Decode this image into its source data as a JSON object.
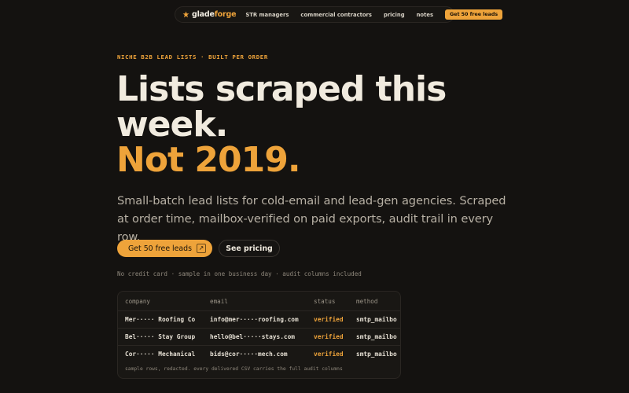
{
  "nav": {
    "brand_prefix": "glade",
    "brand_suffix": "forge",
    "links": [
      "STR managers",
      "commercial contractors",
      "pricing",
      "notes"
    ],
    "cta_label": "Get 50 free leads"
  },
  "hero": {
    "eyebrow": "NICHE B2B LEAD LISTS · BUILT PER ORDER",
    "headline_line1": "Lists scraped this",
    "headline_line2": "week.",
    "headline_accent": "Not 2019.",
    "subhead": "Small-batch lead lists for cold-email and lead-gen agencies. Scraped at order time, mailbox-verified on paid exports, audit trail in every row.",
    "primary_button": "Get 50 free leads",
    "primary_button_icon": "arrow-up-right-icon",
    "secondary_button": "See pricing",
    "fineprint": "No credit card · sample in one business day · audit columns included"
  },
  "sample_table": {
    "columns": [
      "company",
      "email",
      "status",
      "method"
    ],
    "rows": [
      {
        "company": "Mer····· Roofing Co",
        "email": "info@mer·····roofing.com",
        "status": "verified",
        "method": "smtp_mailbo"
      },
      {
        "company": "Bel····· Stay Group",
        "email": "hello@bel·····stays.com",
        "status": "verified",
        "method": "smtp_mailbo"
      },
      {
        "company": "Cor····· Mechanical",
        "email": "bids@cor·····mech.com",
        "status": "verified",
        "method": "smtp_mailbo"
      }
    ],
    "note": "sample rows, redacted. every delivered CSV carries the full audit columns"
  },
  "colors": {
    "background": "#141210",
    "accent": "#eea33a",
    "text": "#efe9dc",
    "muted": "#b7b0a4"
  }
}
